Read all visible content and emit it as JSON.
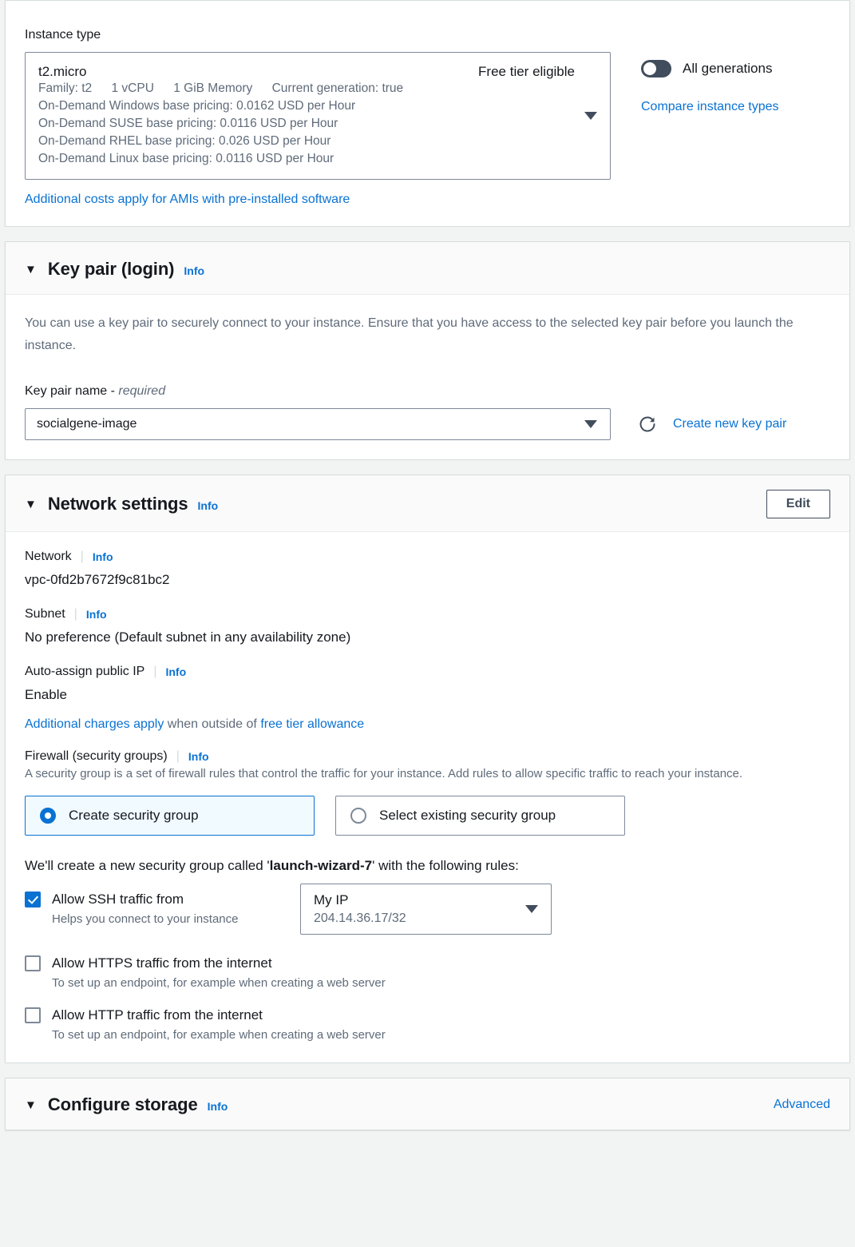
{
  "instance_type_panel": {
    "label": "Instance type",
    "selected": {
      "name": "t2.micro",
      "free_tier": "Free tier eligible",
      "family": "Family: t2",
      "vcpu": "1 vCPU",
      "memory": "1 GiB Memory",
      "current_generation": "Current generation: true",
      "pricing_windows": "On-Demand Windows base pricing: 0.0162 USD per Hour",
      "pricing_suse": "On-Demand SUSE base pricing: 0.0116 USD per Hour",
      "pricing_rhel": "On-Demand RHEL base pricing: 0.026 USD per Hour",
      "pricing_linux": "On-Demand Linux base pricing: 0.0116 USD per Hour"
    },
    "additional_costs_link": "Additional costs apply for AMIs with pre-installed software",
    "all_generations_label": "All generations",
    "all_generations_on": false,
    "compare_link": "Compare instance types"
  },
  "key_pair_panel": {
    "title": "Key pair (login)",
    "info": "Info",
    "description": "You can use a key pair to securely connect to your instance. Ensure that you have access to the selected key pair before you launch the instance.",
    "field_label": "Key pair name - ",
    "field_label_required": "required",
    "selected_key_pair": "socialgene-image",
    "create_link": "Create new key pair"
  },
  "network_panel": {
    "title": "Network settings",
    "info": "Info",
    "edit_label": "Edit",
    "network_label": "Network",
    "network_info": "Info",
    "network_value": "vpc-0fd2b7672f9c81bc2",
    "subnet_label": "Subnet",
    "subnet_info": "Info",
    "subnet_value": "No preference (Default subnet in any availability zone)",
    "auto_ip_label": "Auto-assign public IP",
    "auto_ip_info": "Info",
    "auto_ip_value": "Enable",
    "charges_link": "Additional charges apply",
    "charges_mid": " when outside of ",
    "charges_link2": "free tier allowance",
    "firewall_label": "Firewall (security groups)",
    "firewall_info": "Info",
    "firewall_desc": "A security group is a set of firewall rules that control the traffic for your instance. Add rules to allow specific traffic to reach your instance.",
    "option_create": "Create security group",
    "option_select": "Select existing security group",
    "selected_option": "create",
    "sg_sentence_prefix": "We'll create a new security group called '",
    "sg_name": "launch-wizard-7",
    "sg_sentence_suffix": "' with the following rules:",
    "rules": [
      {
        "label": "Allow SSH traffic from",
        "sub": "Helps you connect to your instance",
        "checked": true,
        "source_main": "My IP",
        "source_sub": "204.14.36.17/32"
      },
      {
        "label": "Allow HTTPS traffic from the internet",
        "sub": "To set up an endpoint, for example when creating a web server",
        "checked": false
      },
      {
        "label": "Allow HTTP traffic from the internet",
        "sub": "To set up an endpoint, for example when creating a web server",
        "checked": false
      }
    ]
  },
  "storage_panel": {
    "title": "Configure storage",
    "info": "Info",
    "advanced": "Advanced"
  },
  "colors": {
    "link": "#0972d3",
    "text": "#16191f",
    "muted": "#5f6b7a",
    "border": "#7d8998",
    "panel_bg": "#ffffff",
    "page_bg": "#f2f3f3"
  }
}
